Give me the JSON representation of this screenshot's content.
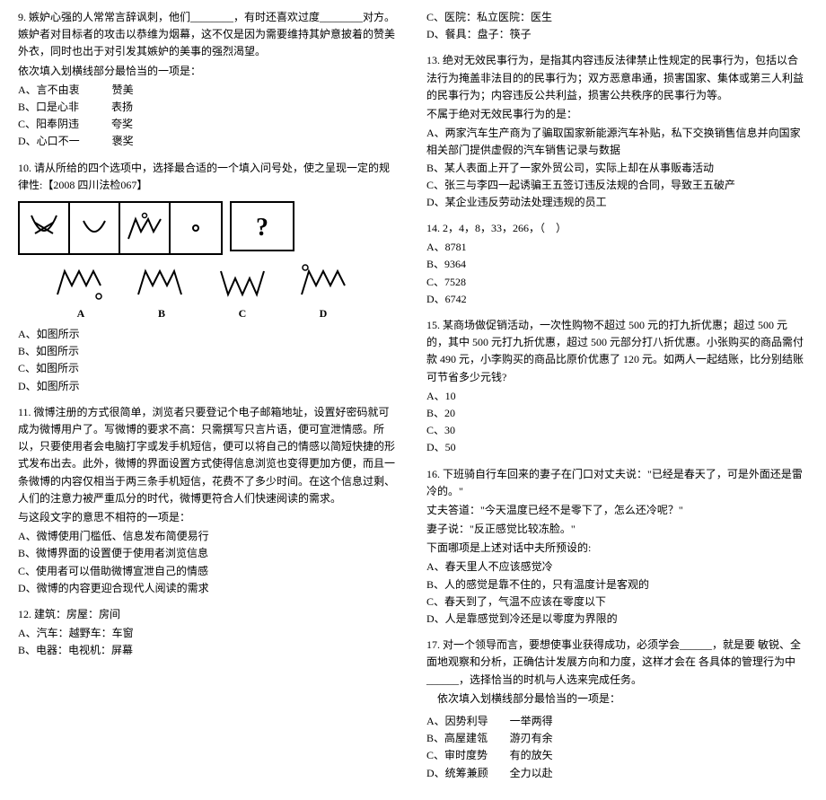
{
  "left": {
    "q9": {
      "stem1": "9. 嫉妒心强的人常常言辞讽刺，他们________，有时还喜欢过度________对方。嫉妒者对目标者的攻击以恭维为烟幕，这不仅是因为需要维持其妒意披着的赞美外衣，同时也出于对引发其嫉妒的美事的强烈渴望。",
      "stem2": "依次填入划横线部分最恰当的一项是：",
      "options": [
        "A、言不由衷　　　赞美",
        "B、口是心非　　　表扬",
        "C、阳奉阴违　　　夸奖",
        "D、心口不一　　　褒奖"
      ]
    },
    "q10": {
      "stem": "10. 请从所给的四个选项中，选择最合适的一个填入问号处，使之呈现一定的规律性:【2008 四川法检067】",
      "topLabels": [
        "A",
        "B",
        "C",
        "D"
      ],
      "options": [
        "A、如图所示",
        "B、如图所示",
        "C、如图所示",
        "D、如图所示"
      ]
    },
    "q11": {
      "stem1": "11. 微博注册的方式很简单，浏览者只要登记个电子邮箱地址，设置好密码就可成为微博用户了。写微博的要求不高：只需撰写只言片语，便可宣泄情感。所以，只要使用者会电脑打字或发手机短信，便可以将自己的情感以简短快捷的形式发布出去。此外，微博的界面设置方式使得信息浏览也变得更加方便，而且一条微博的内容仅相当于两三条手机短信，花费不了多少时间。在这个信息过剩、人们的注意力被严重瓜分的时代，微博更符合人们快速阅读的需求。",
      "stem2": "与这段文字的意思不相符的一项是：",
      "options": [
        "A、微博使用门槛低、信息发布简便易行",
        "B、微博界面的设置便于使用者浏览信息",
        "C、使用者可以借助微博宣泄自己的情感",
        "D、微博的内容更迎合现代人阅读的需求"
      ]
    },
    "q12": {
      "stem": "12. 建筑：房屋：房间",
      "options": [
        "A、汽车：越野车：车窗",
        "B、电器：电视机：屏幕"
      ]
    }
  },
  "right": {
    "q12extra": [
      "C、医院：私立医院：医生",
      "D、餐具：盘子：筷子"
    ],
    "q13": {
      "stem1": "13. 绝对无效民事行为，是指其内容违反法律禁止性规定的民事行为，包括以合法行为掩盖非法目的的民事行为；双方恶意串通，损害国家、集体或第三人利益的民事行为；内容违反公共利益，损害公共秩序的民事行为等。",
      "stem2": "不属于绝对无效民事行为的是：",
      "options": [
        "A、两家汽车生产商为了骗取国家新能源汽车补贴，私下交换销售信息并向国家相关部门提供虚假的汽车销售记录与数据",
        "B、某人表面上开了一家外贸公司，实际上却在从事贩毒活动",
        "C、张三与李四一起诱骗王五签订违反法规的合同，导致王五破产",
        "D、某企业违反劳动法处理违规的员工"
      ]
    },
    "q14": {
      "stem": "14. 2，4，8，33，266，（　）",
      "options": [
        "A、8781",
        "B、9364",
        "C、7528",
        "D、6742"
      ]
    },
    "q15": {
      "stem": "15. 某商场做促销活动，一次性购物不超过 500 元的打九折优惠；超过 500 元的，其中 500 元打九折优惠，超过 500 元部分打八折优惠。小张购买的商品需付款 490 元，小李购买的商品比原价优惠了 120 元。如两人一起结账，比分别结账可节省多少元钱?",
      "options": [
        "A、10",
        "B、20",
        "C、30",
        "D、50"
      ]
    },
    "q16": {
      "line1": "16. 下班骑自行车回来的妻子在门口对丈夫说：\"已经是春天了，可是外面还是雷冷的。\"",
      "line2": "丈夫答道：\"今天温度已经不是零下了，怎么还冷呢？\"",
      "line3": "妻子说：\"反正感觉比较冻脸。\"",
      "line4": "下面哪项是上述对话中夫所预设的:",
      "options": [
        "A、春天里人不应该感觉冷",
        "B、人的感觉是靠不住的，只有温度计是客观的",
        "C、春天到了，气温不应该在零度以下",
        "D、人是靠感觉到冷还是以零度为界限的"
      ]
    },
    "q17": {
      "stem": "17. 对一个领导而言，要想使事业获得成功，必须学会______，就是要 敏锐、全面地观察和分析，正确估计发展方向和力度，这样才会在 各具体的管理行为中______，选择恰当的时机与人选来完成任务。",
      "stem2": "　依次填入划横线部分最恰当的一项是：",
      "options": [
        [
          "A、因势利导",
          "一举两得"
        ],
        [
          "B、高屋建瓴",
          "游刃有余"
        ],
        [
          "C、审时度势",
          "有的放矢"
        ],
        [
          "D、统筹兼顾",
          "全力以赴"
        ]
      ]
    }
  }
}
